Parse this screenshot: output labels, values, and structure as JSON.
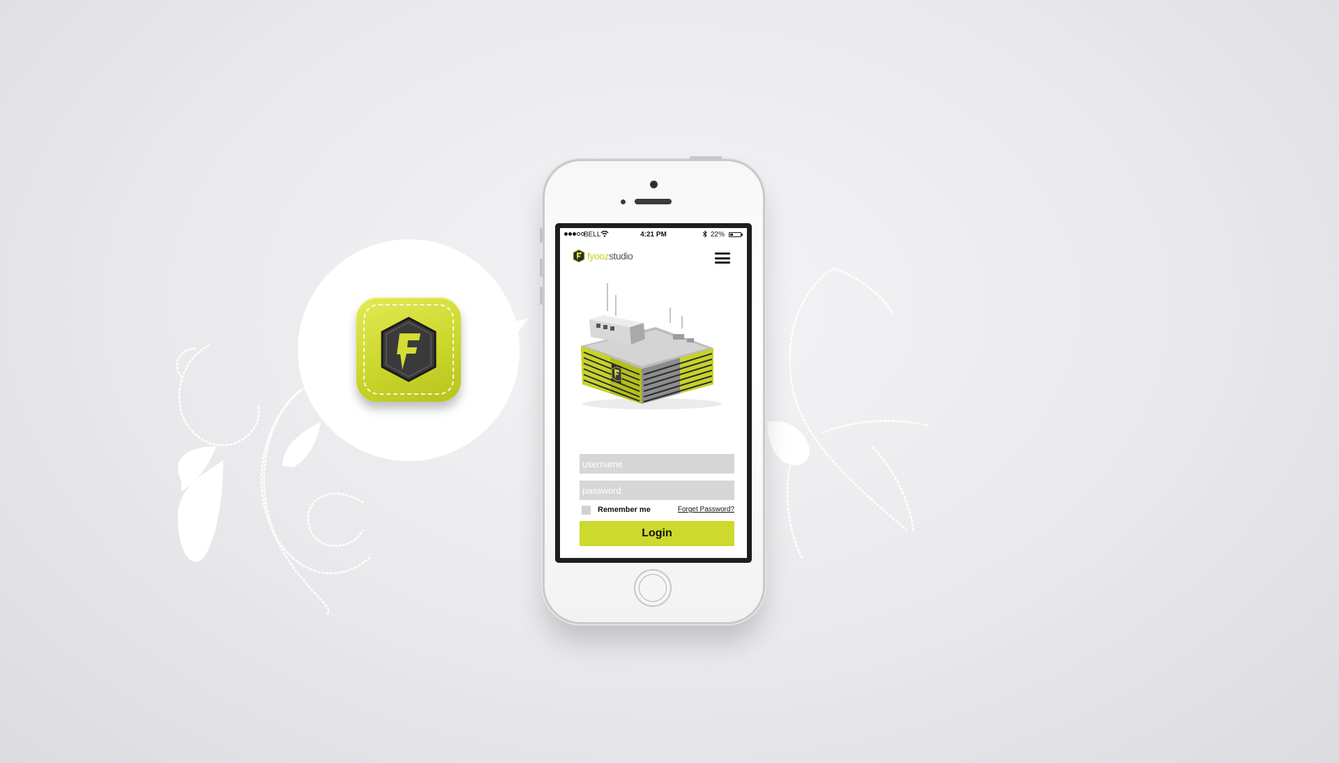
{
  "theme": {
    "accent": "#cdd92c",
    "dark": "#2b2b2b",
    "field_bg": "#d6d6d6"
  },
  "app_icon": {
    "icon": "lightning-f-shield-icon",
    "letter": "F"
  },
  "status_bar": {
    "carrier": "BELL",
    "time": "4:21 PM",
    "battery": "22%"
  },
  "header": {
    "logo_icon": "f-shield-logo-icon",
    "brand_accent": "fyooz",
    "brand_rest": "studio",
    "menu_icon": "hamburger-menu-icon"
  },
  "login": {
    "username_placeholder": "username",
    "password_placeholder": "password",
    "remember_label": "Remember me",
    "forgot_label": "Forget Password?",
    "login_label": "Login"
  }
}
